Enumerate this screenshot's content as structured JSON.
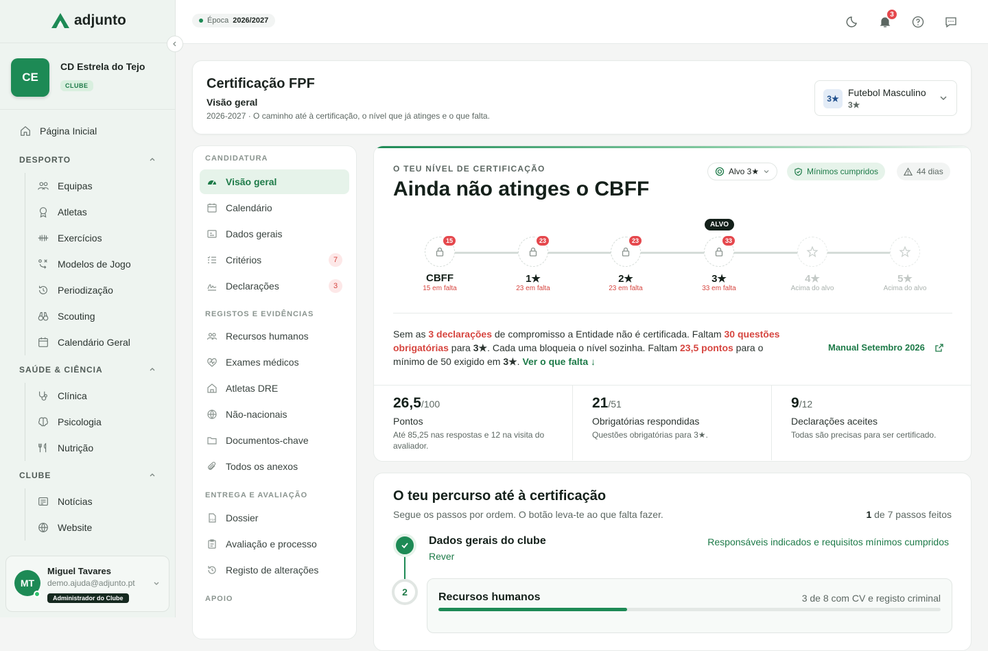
{
  "brand": {
    "name": "adjunto"
  },
  "club": {
    "initials": "CE",
    "name": "CD Estrela do Tejo",
    "tag": "CLUBE"
  },
  "nav": {
    "home": "Página Inicial",
    "sections": [
      {
        "title": "DESPORTO",
        "items": [
          "Equipas",
          "Atletas",
          "Exercícios",
          "Modelos de Jogo",
          "Periodização",
          "Scouting",
          "Calendário Geral"
        ]
      },
      {
        "title": "SAÚDE & CIÊNCIA",
        "items": [
          "Clínica",
          "Psicologia",
          "Nutrição"
        ]
      },
      {
        "title": "CLUBE",
        "items": [
          "Notícias",
          "Website"
        ]
      }
    ]
  },
  "user": {
    "initials": "MT",
    "name": "Miguel Tavares",
    "email": "demo.ajuda@adjunto.pt",
    "role": "Administrador do Clube"
  },
  "topbar": {
    "season_label": "Época",
    "season_value": "2026/2027",
    "notifications": "3"
  },
  "header": {
    "title": "Certificação FPF",
    "subtitle": "Visão geral",
    "description": "2026-2027 · O caminho até à certificação, o nível que já atinges e o que falta.",
    "sport": "Futebol Masculino",
    "sport_badge": "3★",
    "sport_level": "3★"
  },
  "subnav": {
    "sections": [
      {
        "title": "CANDIDATURA",
        "items": [
          {
            "label": "Visão geral",
            "active": true
          },
          {
            "label": "Calendário"
          },
          {
            "label": "Dados gerais"
          },
          {
            "label": "Critérios",
            "count": "7"
          },
          {
            "label": "Declarações",
            "count": "3"
          }
        ]
      },
      {
        "title": "REGISTOS E EVIDÊNCIAS",
        "items": [
          {
            "label": "Recursos humanos"
          },
          {
            "label": "Exames médicos"
          },
          {
            "label": "Atletas DRE"
          },
          {
            "label": "Não-nacionais"
          },
          {
            "label": "Documentos-chave"
          },
          {
            "label": "Todos os anexos"
          }
        ]
      },
      {
        "title": "ENTREGA E AVALIAÇÃO",
        "items": [
          {
            "label": "Dossier"
          },
          {
            "label": "Avaliação e processo"
          },
          {
            "label": "Registo de alterações"
          }
        ]
      },
      {
        "title": "APOIO",
        "items": []
      }
    ]
  },
  "level": {
    "eyebrow": "O TEU NÍVEL DE CERTIFICAÇÃO",
    "headline": "Ainda não atinges o CBFF",
    "target_pill": "Alvo 3★",
    "minimums_pill": "Mínimos cumpridos",
    "days_pill": "44 dias",
    "target_tag": "ALVO",
    "steps": [
      {
        "label": "CBFF",
        "badge": "15",
        "sub": "15 em falta",
        "locked": true
      },
      {
        "label": "1★",
        "badge": "23",
        "sub": "23 em falta",
        "locked": true
      },
      {
        "label": "2★",
        "badge": "23",
        "sub": "23 em falta",
        "locked": true
      },
      {
        "label": "3★",
        "badge": "33",
        "sub": "33 em falta",
        "locked": true
      },
      {
        "label": "4★",
        "sub": "Acima do alvo",
        "locked": false
      },
      {
        "label": "5★",
        "sub": "Acima do alvo",
        "locked": false
      }
    ],
    "msg": {
      "p1": "Sem as ",
      "r1": "3 declarações",
      "p2": " de compromisso a Entidade não é certificada. Faltam ",
      "r2": "30 questões obrigatórias",
      "p3": " para ",
      "b1": "3★",
      "p4": ". Cada uma bloqueia o nível sozinha. Faltam ",
      "r3": "23,5 pontos",
      "p5": " para o mínimo de 50 exigido em ",
      "b2": "3★",
      "p6": ". ",
      "link": "Ver o que falta ↓"
    },
    "manual": "Manual Setembro 2026",
    "stats": [
      {
        "value": "26,5",
        "total": "/100",
        "label": "Pontos",
        "desc": "Até 85,25 nas respostas e 12 na visita do avaliador."
      },
      {
        "value": "21",
        "total": "/51",
        "label": "Obrigatórias respondidas",
        "desc": "Questões obrigatórias para 3★."
      },
      {
        "value": "9",
        "total": "/12",
        "label": "Declarações aceites",
        "desc": "Todas são precisas para ser certificado."
      }
    ]
  },
  "path": {
    "title": "O teu percurso até à certificação",
    "subtitle": "Segue os passos por ordem. O botão leva-te ao que falta fazer.",
    "done": "1",
    "of": " de 7 passos feitos",
    "steps": [
      {
        "title": "Dados gerais do clube",
        "action": "Rever",
        "status": "Responsáveis indicados e requisitos mínimos cumpridos"
      },
      {
        "num": "2",
        "title": "Recursos humanos",
        "status": "3 de 8 com CV e registo criminal",
        "progress": 0.375
      }
    ]
  }
}
